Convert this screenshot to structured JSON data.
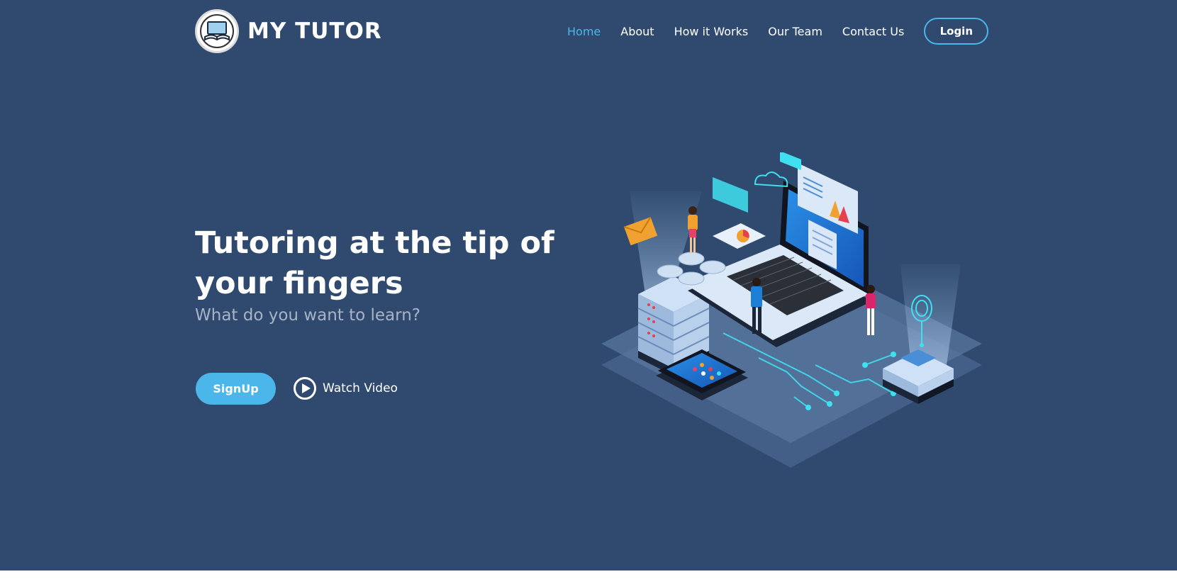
{
  "brand": {
    "name": "MY TUTOR",
    "logo_icon": "open-book-laptop-icon"
  },
  "nav": {
    "items": [
      {
        "label": "Home",
        "active": true
      },
      {
        "label": "About",
        "active": false
      },
      {
        "label": "How it Works",
        "active": false
      },
      {
        "label": "Our Team",
        "active": false
      },
      {
        "label": "Contact Us",
        "active": false
      }
    ],
    "login_label": "Login"
  },
  "hero": {
    "title": "Tutoring at the tip of your fingers",
    "subtitle": "What do you want to learn?",
    "signup_label": "SignUp",
    "watch_video_label": "Watch Video",
    "watch_video_icon": "play-circle-icon"
  },
  "illustration": {
    "icon": "isometric-online-learning-illustration"
  },
  "colors": {
    "background": "#2f4a6e",
    "accent": "#4bb6ea",
    "subtitle": "#a7b3c6",
    "text": "#ffffff"
  }
}
